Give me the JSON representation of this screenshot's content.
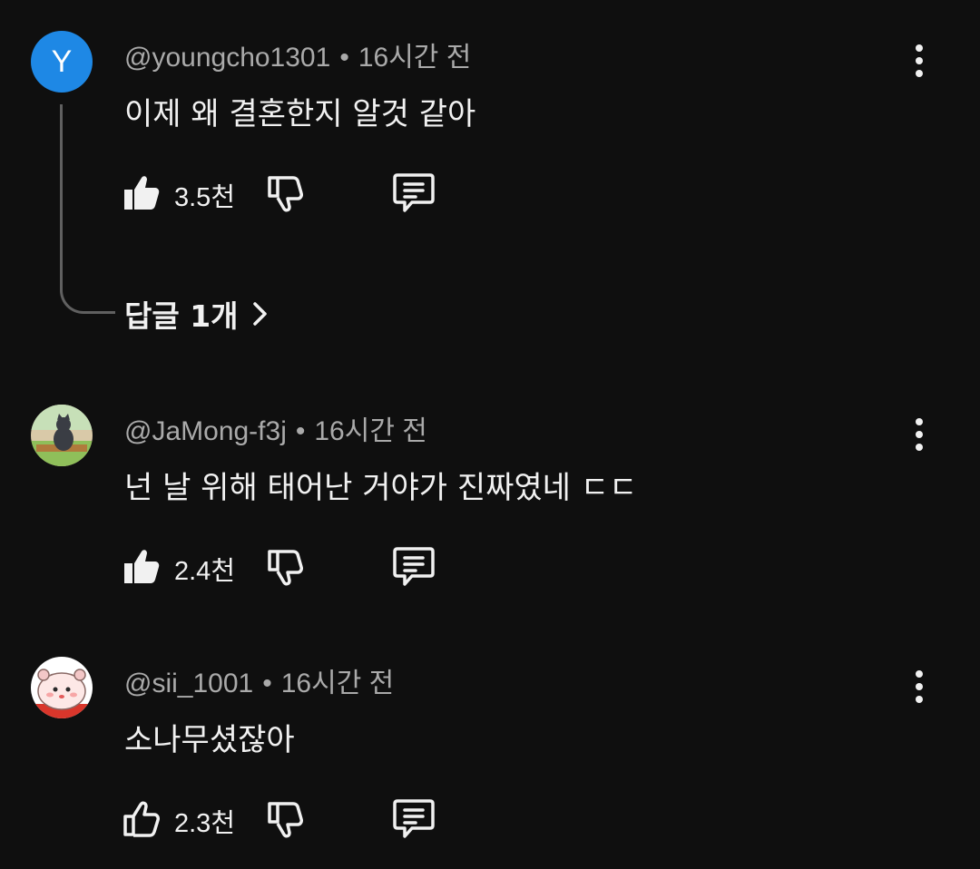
{
  "comments": [
    {
      "avatar_letter": "Y",
      "avatar_color": "#1e88e5",
      "handle": "@youngcho1301",
      "time": "16시간 전",
      "text": "이제 왜 결혼한지 알것 같아",
      "likes": "3.5천",
      "liked": true,
      "replies_label": "답글 1개"
    },
    {
      "avatar": "cat-photo",
      "handle": "@JaMong-f3j",
      "time": "16시간 전",
      "text": "넌 날 위해 태어난 거야가 진짜였네 ㄷㄷ",
      "likes": "2.4천",
      "liked": true
    },
    {
      "avatar": "hamster-drawing",
      "handle": "@sii_1001",
      "time": "16시간 전",
      "text": "소나무셨잖아",
      "likes": "2.3천",
      "liked": false
    }
  ],
  "separator": "•",
  "icons": {
    "like": "thumbs-up-icon",
    "dislike": "thumbs-down-icon",
    "reply": "comment-icon",
    "menu": "more-vert-icon",
    "chevron": "chevron-right-icon"
  }
}
